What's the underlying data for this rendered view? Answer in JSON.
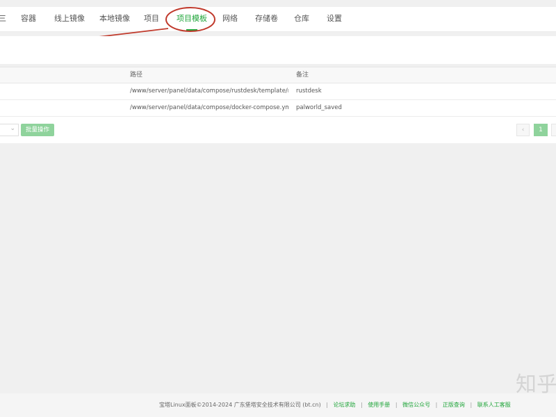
{
  "tabs": [
    {
      "label": "三"
    },
    {
      "label": "容器"
    },
    {
      "label": "线上镜像"
    },
    {
      "label": "本地镜像"
    },
    {
      "label": "项目"
    },
    {
      "label": "项目模板",
      "active": true
    },
    {
      "label": "网络"
    },
    {
      "label": "存储卷"
    },
    {
      "label": "仓库"
    },
    {
      "label": "设置"
    }
  ],
  "table": {
    "columns": {
      "path": "路径",
      "note": "备注"
    },
    "rows": [
      {
        "path": "/www/server/panel/data/compose/rustdesk/template/rust...",
        "note": "rustdesk"
      },
      {
        "path": "/www/server/panel/data/compose/docker-compose.yml/t...",
        "note": "palworld_saved"
      }
    ]
  },
  "batch_button": "批量操作",
  "pagination": {
    "prev": "‹",
    "current": "1"
  },
  "footer": {
    "copyright": "宝塔Linux面板©2014-2024 广东堡塔安全技术有限公司 (bt.cn)",
    "links": [
      "论坛求助",
      "使用手册",
      "微信公众号",
      "正版查询",
      "联系人工客服"
    ]
  },
  "watermark": "知乎",
  "colors": {
    "accent": "#20a53a",
    "annotation": "#c0392b"
  }
}
